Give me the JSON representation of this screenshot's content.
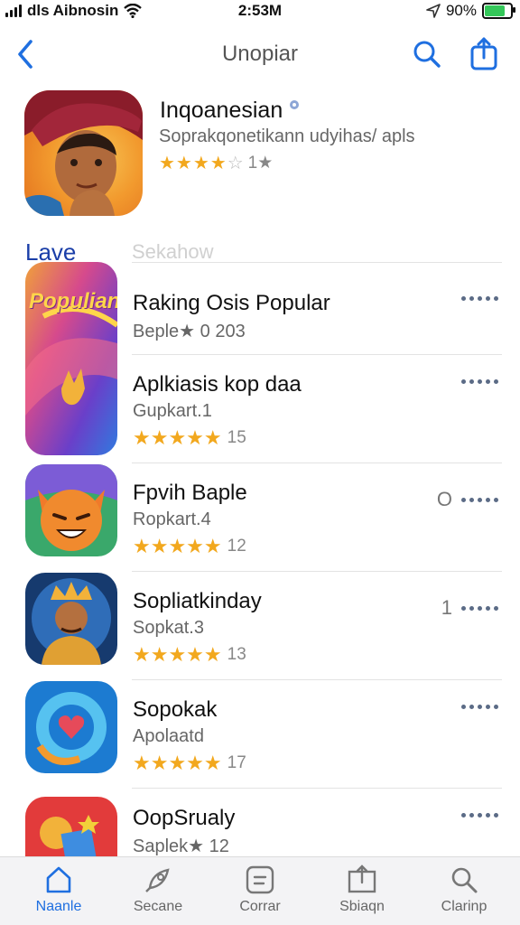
{
  "status_bar": {
    "carrier": "dls Aibnosin",
    "time": "2:53M",
    "battery": "90%",
    "battery_level": 0.9
  },
  "nav": {
    "title": "Unopiar",
    "back_icon": "chevron-left-icon",
    "search_icon": "search-icon",
    "share_icon": "share-icon"
  },
  "featured": {
    "title": "Inqoanesian",
    "subtitle": "Soprakqonetikann udyihas/ apls",
    "rating_value": 3.5,
    "rating_count": "1★"
  },
  "section": {
    "title": "Lave",
    "tab_label": "Sekahow"
  },
  "apps": [
    {
      "icon_label": "Populian",
      "name": "Raking Osis Popular",
      "subtitle": "Beple★ 0 203",
      "rating_stars": 0,
      "rating_count": "",
      "extra": ""
    },
    {
      "icon_label": "",
      "name": "Aplkiasis kop daa",
      "subtitle": "Gupkart.1",
      "rating_stars": 5,
      "rating_count": "15",
      "extra": ""
    },
    {
      "icon_label": "",
      "name": "Fpvih Baple",
      "subtitle": "Ropkart.4",
      "rating_stars": 5,
      "rating_count": "12",
      "extra": "O"
    },
    {
      "icon_label": "",
      "name": "Sopliatkinday",
      "subtitle": "Sopkat.3",
      "rating_stars": 5,
      "rating_count": "13",
      "extra": "1"
    },
    {
      "icon_label": "",
      "name": "Sopokak",
      "subtitle": "Apolaatd",
      "rating_stars": 5,
      "rating_count": "17",
      "extra": ""
    },
    {
      "icon_label": "",
      "name": "OopSrualy",
      "subtitle": "Saplek★ 12",
      "rating_stars": 0,
      "rating_count": "",
      "extra": ""
    }
  ],
  "tabs": [
    {
      "label": "Naanle",
      "icon": "home-icon",
      "active": true
    },
    {
      "label": "Secane",
      "icon": "rocket-icon",
      "active": false
    },
    {
      "label": "Corrar",
      "icon": "apps-icon",
      "active": false
    },
    {
      "label": "Sbiaqn",
      "icon": "arcade-icon",
      "active": false
    },
    {
      "label": "Clarinp",
      "icon": "search-icon",
      "active": false
    }
  ],
  "colors": {
    "accent": "#1f6fe0",
    "star": "#f2a81e",
    "section_title": "#1a3ea8"
  }
}
